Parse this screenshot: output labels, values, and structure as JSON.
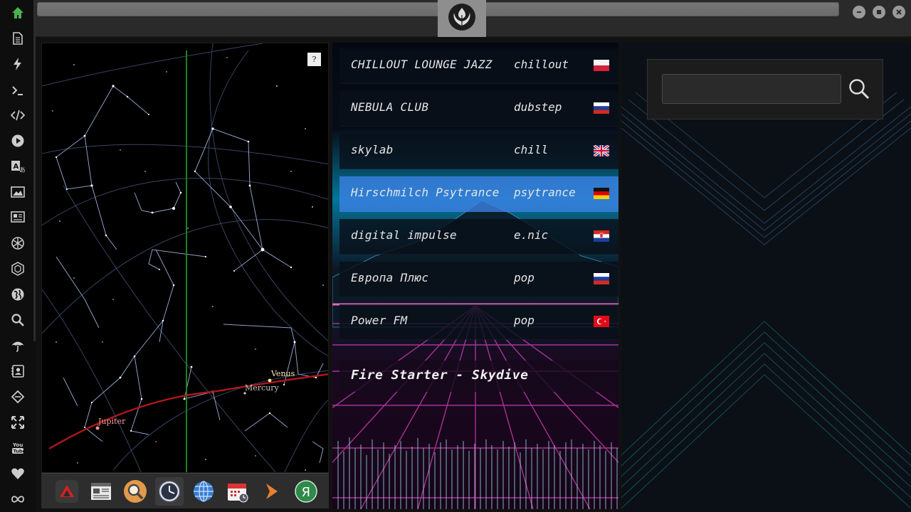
{
  "sidebar": {
    "items": [
      {
        "name": "home-icon",
        "color": "#4caf50"
      },
      {
        "name": "document-icon"
      },
      {
        "name": "lightning-icon"
      },
      {
        "name": "terminal-icon"
      },
      {
        "name": "code-icon"
      },
      {
        "name": "play-icon"
      },
      {
        "name": "translate-icon"
      },
      {
        "name": "image-icon"
      },
      {
        "name": "news-icon"
      },
      {
        "name": "rebel-icon"
      },
      {
        "name": "hexagon-icon"
      },
      {
        "name": "globe-icon"
      },
      {
        "name": "search-icon"
      },
      {
        "name": "umbrella-icon"
      },
      {
        "name": "contact-icon"
      },
      {
        "name": "diamond-icon"
      },
      {
        "name": "fullscreen-icon"
      },
      {
        "name": "youtube-icon"
      },
      {
        "name": "heart-icon"
      },
      {
        "name": "infinity-icon"
      }
    ]
  },
  "starmap": {
    "help_label": "?",
    "planets": {
      "venus": "Venus",
      "mercury": "Mercury",
      "jupiter": "Jupiter"
    }
  },
  "dock": {
    "items": [
      {
        "name": "triangle-app-icon"
      },
      {
        "name": "news-app-icon"
      },
      {
        "name": "search-app-icon"
      },
      {
        "name": "clock-app-icon",
        "active": true
      },
      {
        "name": "globe-app-icon"
      },
      {
        "name": "calendar-app-icon"
      },
      {
        "name": "arrow-app-icon"
      },
      {
        "name": "yandex-app-icon",
        "label": "Я"
      }
    ]
  },
  "radio": {
    "stations": [
      {
        "name": "CHILLOUT LOUNGE JAZZ",
        "genre": "chillout",
        "flag": "pl"
      },
      {
        "name": "NEBULA CLUB",
        "genre": "dubstep",
        "flag": "ru"
      },
      {
        "name": "skylab",
        "genre": "chill",
        "flag": "uk"
      },
      {
        "name": "Hirschmilch Psytrance",
        "genre": "psytrance",
        "flag": "de",
        "selected": true
      },
      {
        "name": "digital impulse",
        "genre": "e.nic",
        "flag": "hr"
      },
      {
        "name": "Европа Плюс",
        "genre": "pop",
        "flag": "ru"
      },
      {
        "name": "Power FM",
        "genre": "pop",
        "flag": "tr"
      }
    ],
    "now_playing": "Fire Starter - Skydive"
  },
  "search": {
    "value": "",
    "placeholder": ""
  },
  "colors": {
    "selected_row": "#3c82e6",
    "ecliptic": "#b01818",
    "meridian": "#1f8f1f"
  }
}
